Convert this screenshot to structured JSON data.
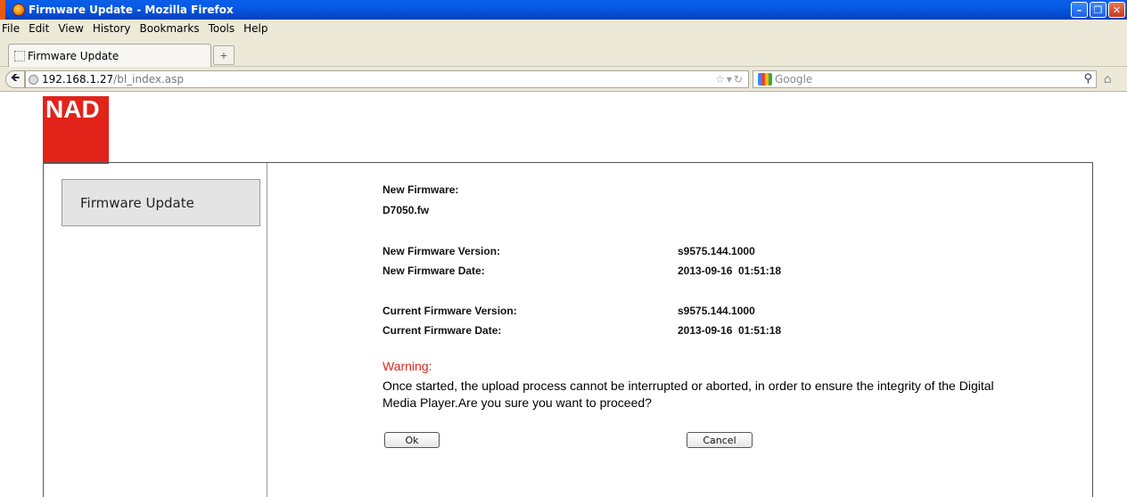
{
  "window": {
    "title": "Firmware Update - Mozilla Firefox"
  },
  "menu": [
    "File",
    "Edit",
    "View",
    "History",
    "Bookmarks",
    "Tools",
    "Help"
  ],
  "tab": {
    "label": "Firmware Update",
    "new_tab": "+"
  },
  "nav": {
    "url_host": "192.168.1.27",
    "url_path": "/bl_index.asp",
    "search_placeholder": "Google"
  },
  "brand": {
    "logo_text": "NAD",
    "color": "#e2231a"
  },
  "sidebar": {
    "button_label": "Firmware Update"
  },
  "firmware": {
    "new_firmware_label": "New Firmware:",
    "new_firmware_file": "D7050.fw",
    "new_version_label": "New Firmware Version:",
    "new_version_value": "s9575.144.1000",
    "new_date_label": "New Firmware Date:",
    "new_date_value": "2013-09-16  01:51:18",
    "current_version_label": "Current Firmware Version:",
    "current_version_value": "s9575.144.1000",
    "current_date_label": "Current Firmware Date:",
    "current_date_value": "2013-09-16  01:51:18"
  },
  "warning": {
    "title": "Warning:",
    "text": "Once started, the upload process cannot be interrupted or aborted, in order to ensure the integrity of the Digital Media Player.Are you sure you want to proceed?"
  },
  "buttons": {
    "ok": "Ok",
    "cancel": "Cancel"
  }
}
